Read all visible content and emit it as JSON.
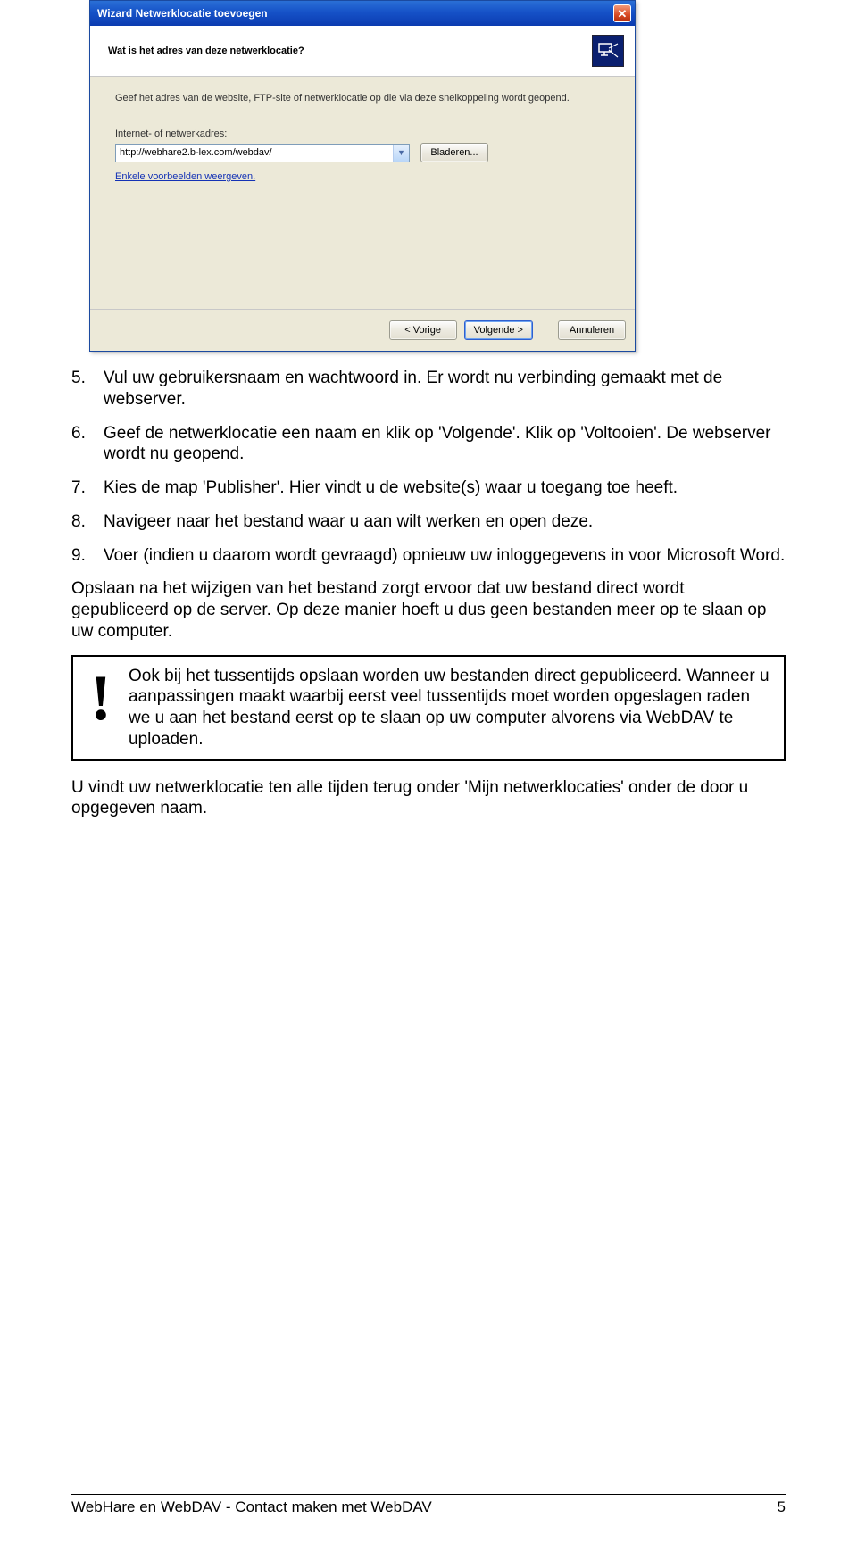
{
  "wizard": {
    "title": "Wizard Netwerklocatie toevoegen",
    "heading": "Wat is het adres van deze netwerklocatie?",
    "intro": "Geef het adres van de website, FTP-site of netwerklocatie op die via deze snelkoppeling wordt geopend.",
    "field_label": "Internet- of netwerkadres:",
    "address_value": "http://webhare2.b-lex.com/webdav/",
    "browse_label": "Bladeren...",
    "examples_label": "Enkele voorbeelden weergeven.",
    "btn_prev": "< Vorige",
    "btn_next": "Volgende >",
    "btn_cancel": "Annuleren",
    "close_glyph": "✕"
  },
  "list": [
    {
      "n": "5.",
      "text": "Vul uw gebruikersnaam en wachtwoord in. Er wordt nu verbinding gemaakt met de webserver."
    },
    {
      "n": "6.",
      "text": "Geef de netwerklocatie een naam en klik op 'Volgende'. Klik op 'Voltooien'. De webserver wordt nu geopend."
    },
    {
      "n": "7.",
      "text": "Kies de map 'Publisher'. Hier vindt u de website(s) waar u toegang toe heeft."
    },
    {
      "n": "8.",
      "text": "Navigeer naar het bestand waar u aan wilt werken en open deze."
    },
    {
      "n": "9.",
      "text": "Voer (indien u daarom wordt gevraagd) opnieuw uw inloggegevens in voor Microsoft Word."
    }
  ],
  "para1": "Opslaan na het wijzigen van het bestand zorgt ervoor dat uw bestand direct wordt gepubliceerd op de server. Op deze manier hoeft u dus geen bestanden meer op te slaan op uw computer.",
  "callout": {
    "bang": "!",
    "text": "Ook bij het tussentijds opslaan worden uw bestanden direct gepubliceerd. Wanneer u aanpassingen maakt waarbij eerst veel tussentijds moet worden opgeslagen raden we u aan het bestand eerst op te slaan op uw computer alvorens via WebDAV te uploaden."
  },
  "para2": "U vindt uw netwerklocatie ten alle tijden terug onder 'Mijn netwerklocaties' onder de door u opgegeven naam.",
  "footer": {
    "left": "WebHare en WebDAV - Contact maken met WebDAV",
    "right": "5"
  }
}
